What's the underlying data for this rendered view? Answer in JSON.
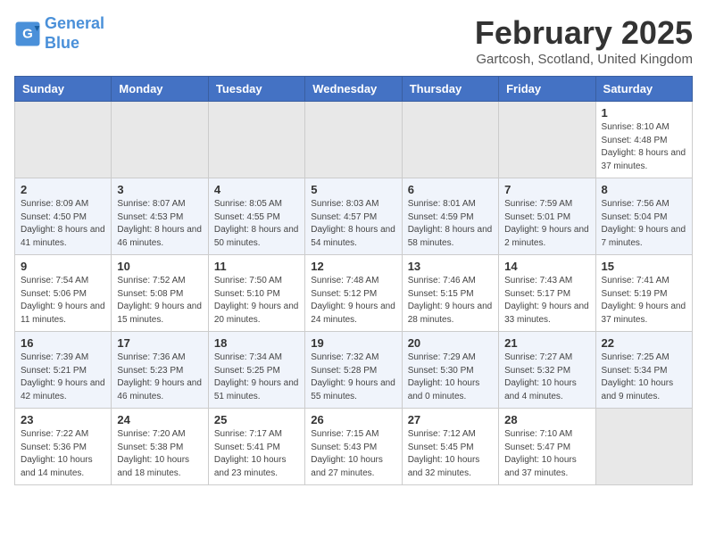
{
  "header": {
    "logo_line1": "General",
    "logo_line2": "Blue",
    "month": "February 2025",
    "location": "Gartcosh, Scotland, United Kingdom"
  },
  "weekdays": [
    "Sunday",
    "Monday",
    "Tuesday",
    "Wednesday",
    "Thursday",
    "Friday",
    "Saturday"
  ],
  "weeks": [
    [
      {
        "day": "",
        "info": ""
      },
      {
        "day": "",
        "info": ""
      },
      {
        "day": "",
        "info": ""
      },
      {
        "day": "",
        "info": ""
      },
      {
        "day": "",
        "info": ""
      },
      {
        "day": "",
        "info": ""
      },
      {
        "day": "1",
        "info": "Sunrise: 8:10 AM\nSunset: 4:48 PM\nDaylight: 8 hours and 37 minutes."
      }
    ],
    [
      {
        "day": "2",
        "info": "Sunrise: 8:09 AM\nSunset: 4:50 PM\nDaylight: 8 hours and 41 minutes."
      },
      {
        "day": "3",
        "info": "Sunrise: 8:07 AM\nSunset: 4:53 PM\nDaylight: 8 hours and 46 minutes."
      },
      {
        "day": "4",
        "info": "Sunrise: 8:05 AM\nSunset: 4:55 PM\nDaylight: 8 hours and 50 minutes."
      },
      {
        "day": "5",
        "info": "Sunrise: 8:03 AM\nSunset: 4:57 PM\nDaylight: 8 hours and 54 minutes."
      },
      {
        "day": "6",
        "info": "Sunrise: 8:01 AM\nSunset: 4:59 PM\nDaylight: 8 hours and 58 minutes."
      },
      {
        "day": "7",
        "info": "Sunrise: 7:59 AM\nSunset: 5:01 PM\nDaylight: 9 hours and 2 minutes."
      },
      {
        "day": "8",
        "info": "Sunrise: 7:56 AM\nSunset: 5:04 PM\nDaylight: 9 hours and 7 minutes."
      }
    ],
    [
      {
        "day": "9",
        "info": "Sunrise: 7:54 AM\nSunset: 5:06 PM\nDaylight: 9 hours and 11 minutes."
      },
      {
        "day": "10",
        "info": "Sunrise: 7:52 AM\nSunset: 5:08 PM\nDaylight: 9 hours and 15 minutes."
      },
      {
        "day": "11",
        "info": "Sunrise: 7:50 AM\nSunset: 5:10 PM\nDaylight: 9 hours and 20 minutes."
      },
      {
        "day": "12",
        "info": "Sunrise: 7:48 AM\nSunset: 5:12 PM\nDaylight: 9 hours and 24 minutes."
      },
      {
        "day": "13",
        "info": "Sunrise: 7:46 AM\nSunset: 5:15 PM\nDaylight: 9 hours and 28 minutes."
      },
      {
        "day": "14",
        "info": "Sunrise: 7:43 AM\nSunset: 5:17 PM\nDaylight: 9 hours and 33 minutes."
      },
      {
        "day": "15",
        "info": "Sunrise: 7:41 AM\nSunset: 5:19 PM\nDaylight: 9 hours and 37 minutes."
      }
    ],
    [
      {
        "day": "16",
        "info": "Sunrise: 7:39 AM\nSunset: 5:21 PM\nDaylight: 9 hours and 42 minutes."
      },
      {
        "day": "17",
        "info": "Sunrise: 7:36 AM\nSunset: 5:23 PM\nDaylight: 9 hours and 46 minutes."
      },
      {
        "day": "18",
        "info": "Sunrise: 7:34 AM\nSunset: 5:25 PM\nDaylight: 9 hours and 51 minutes."
      },
      {
        "day": "19",
        "info": "Sunrise: 7:32 AM\nSunset: 5:28 PM\nDaylight: 9 hours and 55 minutes."
      },
      {
        "day": "20",
        "info": "Sunrise: 7:29 AM\nSunset: 5:30 PM\nDaylight: 10 hours and 0 minutes."
      },
      {
        "day": "21",
        "info": "Sunrise: 7:27 AM\nSunset: 5:32 PM\nDaylight: 10 hours and 4 minutes."
      },
      {
        "day": "22",
        "info": "Sunrise: 7:25 AM\nSunset: 5:34 PM\nDaylight: 10 hours and 9 minutes."
      }
    ],
    [
      {
        "day": "23",
        "info": "Sunrise: 7:22 AM\nSunset: 5:36 PM\nDaylight: 10 hours and 14 minutes."
      },
      {
        "day": "24",
        "info": "Sunrise: 7:20 AM\nSunset: 5:38 PM\nDaylight: 10 hours and 18 minutes."
      },
      {
        "day": "25",
        "info": "Sunrise: 7:17 AM\nSunset: 5:41 PM\nDaylight: 10 hours and 23 minutes."
      },
      {
        "day": "26",
        "info": "Sunrise: 7:15 AM\nSunset: 5:43 PM\nDaylight: 10 hours and 27 minutes."
      },
      {
        "day": "27",
        "info": "Sunrise: 7:12 AM\nSunset: 5:45 PM\nDaylight: 10 hours and 32 minutes."
      },
      {
        "day": "28",
        "info": "Sunrise: 7:10 AM\nSunset: 5:47 PM\nDaylight: 10 hours and 37 minutes."
      },
      {
        "day": "",
        "info": ""
      }
    ]
  ]
}
